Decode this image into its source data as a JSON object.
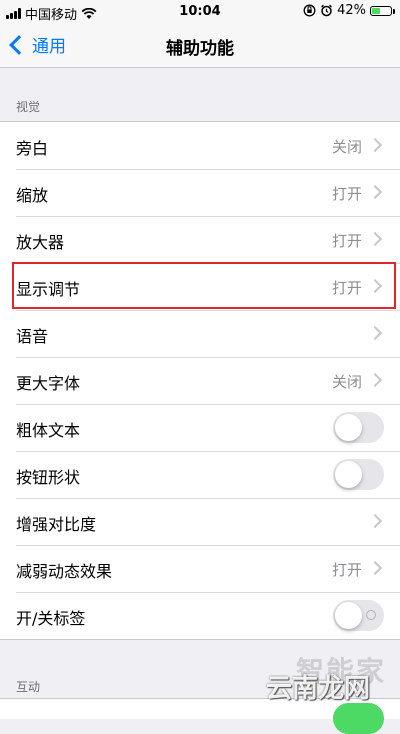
{
  "status_bar": {
    "carrier": "中国移动",
    "time": "10:04",
    "battery_percent": "42%",
    "battery_level": 0.42
  },
  "nav": {
    "back_label": "通用",
    "title": "辅助功能"
  },
  "sections": [
    {
      "header": "视觉",
      "rows": [
        {
          "label": "旁白",
          "value": "关闭",
          "type": "link"
        },
        {
          "label": "缩放",
          "value": "打开",
          "type": "link"
        },
        {
          "label": "放大器",
          "value": "打开",
          "type": "link"
        },
        {
          "label": "显示调节",
          "value": "打开",
          "type": "link"
        },
        {
          "label": "语音",
          "value": "",
          "type": "link"
        },
        {
          "label": "更大字体",
          "value": "关闭",
          "type": "link"
        },
        {
          "label": "粗体文本",
          "type": "toggle",
          "on": false
        },
        {
          "label": "按钮形状",
          "type": "toggle",
          "on": false
        },
        {
          "label": "增强对比度",
          "value": "",
          "type": "link"
        },
        {
          "label": "减弱动态效果",
          "value": "打开",
          "type": "link"
        },
        {
          "label": "开/关标签",
          "type": "toggle",
          "on": false
        }
      ]
    },
    {
      "header": "互动"
    }
  ],
  "watermark": {
    "text1": "智能家",
    "text2": "云南龙网"
  },
  "colors": {
    "accent": "#007aff",
    "highlight_border": "#e0262b",
    "toggle_on": "#4cd964"
  }
}
